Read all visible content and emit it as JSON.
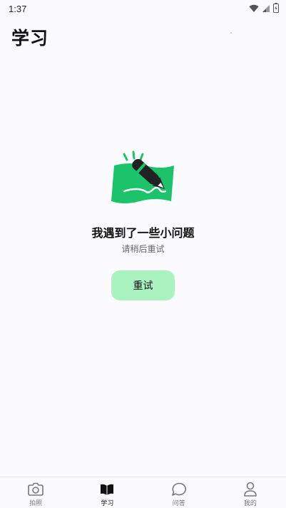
{
  "status_bar": {
    "time": "1:37",
    "icons": [
      "wifi-icon",
      "signal-icon",
      "battery-icon"
    ]
  },
  "header": {
    "title": "学习"
  },
  "error_state": {
    "illustration": "pen-writing-illustration",
    "title": "我遇到了一些小问题",
    "subtitle": "请稍后重试",
    "retry_label": "重试",
    "accent_color": "#1cc36b",
    "button_color": "#aaf3c1"
  },
  "bottom_nav": {
    "items": [
      {
        "label": "拍照",
        "icon": "camera-icon",
        "active": false
      },
      {
        "label": "学习",
        "icon": "book-icon",
        "active": true
      },
      {
        "label": "问答",
        "icon": "chat-bubble-icon",
        "active": false
      },
      {
        "label": "我的",
        "icon": "user-icon",
        "active": false
      }
    ]
  }
}
